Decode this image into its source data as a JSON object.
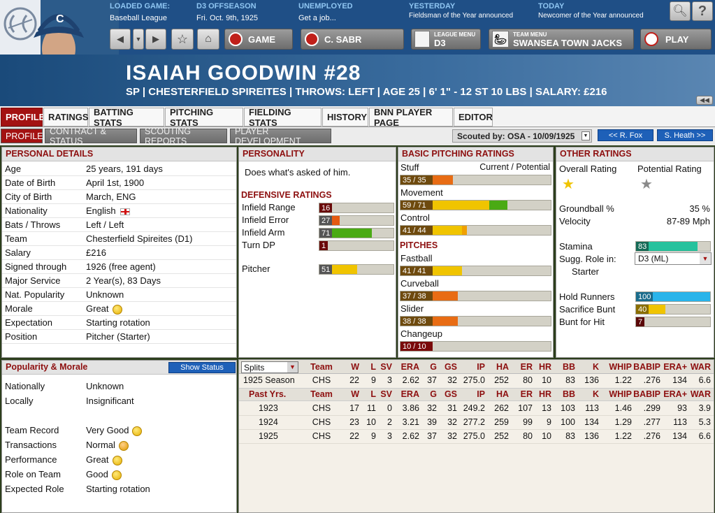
{
  "header": {
    "loaded_game": {
      "label": "LOADED GAME:",
      "value": "Baseball League"
    },
    "phase": {
      "label": "D3 OFFSEASON",
      "value": "Fri. Oct. 9th, 1925"
    },
    "status": {
      "label": "UNEMPLOYED",
      "value": "Get a job..."
    },
    "yesterday": {
      "label": "YESTERDAY",
      "value": "Fieldsman of the Year announced"
    },
    "today": {
      "label": "TODAY",
      "value": "Newcomer of the Year announced"
    },
    "buttons": {
      "game": "GAME",
      "team_short": "C. SABR",
      "league_menu_label": "LEAGUE MENU",
      "league": "D3",
      "team_menu_label": "TEAM MENU",
      "team": "SWANSEA TOWN JACKS",
      "play": "PLAY"
    },
    "cap_letter": "C"
  },
  "player": {
    "name": "ISAIAH GOODWIN  #28",
    "subtitle": "SP | CHESTERFIELD SPIREITES | THROWS: LEFT | AGE 25 | 6' 1\" - 12 ST 10 LBS | SALARY: £216"
  },
  "tabs": [
    "PROFILE",
    "RATINGS",
    "BATTING STATS",
    "PITCHING STATS",
    "FIELDING STATS",
    "HISTORY",
    "BNN PLAYER PAGE",
    "EDITOR"
  ],
  "subtabs": [
    "PROFILE",
    "CONTRACT & STATUS",
    "SCOUTING REPORTS",
    "PLAYER DEVELOPMENT"
  ],
  "scouted_by": "Scouted by: OSA - 10/09/1925",
  "prev_player": "<< R. Fox",
  "next_player": "S. Heath >>",
  "personal": {
    "title": "PERSONAL DETAILS",
    "rows": [
      {
        "k": "Age",
        "v": "25 years, 191 days"
      },
      {
        "k": "Date of Birth",
        "v": "April 1st, 1900"
      },
      {
        "k": "City of Birth",
        "v": "March, ENG"
      },
      {
        "k": "Nationality",
        "v": "English"
      },
      {
        "k": "Bats / Throws",
        "v": "Left / Left"
      },
      {
        "k": "Team",
        "v": "Chesterfield Spireites (D1)"
      },
      {
        "k": "Salary",
        "v": "£216"
      },
      {
        "k": "Signed through",
        "v": "1926 (free agent)"
      },
      {
        "k": "Major Service",
        "v": "2 Year(s), 83 Days"
      },
      {
        "k": "Nat. Popularity",
        "v": "Unknown"
      },
      {
        "k": "Morale",
        "v": "Great"
      },
      {
        "k": "Expectation",
        "v": "Starting rotation"
      },
      {
        "k": "Position",
        "v": "Pitcher (Starter)"
      }
    ]
  },
  "popularity": {
    "title": "Popularity & Morale",
    "show_status": "Show Status",
    "rows": [
      {
        "k": "Nationally",
        "v": "Unknown"
      },
      {
        "k": "Locally",
        "v": "Insignificant"
      },
      {
        "k": "Team Record",
        "v": "Very Good"
      },
      {
        "k": "Transactions",
        "v": "Normal"
      },
      {
        "k": "Performance",
        "v": "Great"
      },
      {
        "k": "Role on Team",
        "v": "Good"
      },
      {
        "k": "Expected Role",
        "v": "Starting rotation"
      }
    ]
  },
  "personality": {
    "title": "PERSONALITY",
    "text": "Does what's asked of him."
  },
  "defensive": {
    "title": "DEFENSIVE RATINGS",
    "rows": [
      {
        "k": "Infield Range",
        "v": "16",
        "level": 16,
        "color": "#b01515"
      },
      {
        "k": "Infield Error",
        "v": "27",
        "level": 27,
        "color": "#e55a10"
      },
      {
        "k": "Infield Arm",
        "v": "71",
        "level": 71,
        "color": "#4aaa14"
      },
      {
        "k": "Turn DP",
        "v": "1",
        "level": 1,
        "color": "#666666"
      }
    ],
    "pitcher": {
      "k": "Pitcher",
      "v": "51",
      "level": 51,
      "color": "#f0c400"
    }
  },
  "pitching": {
    "title": "BASIC PITCHING RATINGS",
    "current_potential": "Current / Potential",
    "ratings": [
      {
        "k": "Stuff",
        "v": "35 / 35",
        "cur": 35,
        "pot": 35,
        "color": "#e86c14"
      },
      {
        "k": "Movement",
        "v": "59 / 71",
        "cur": 59,
        "pot": 71,
        "color": "#f0c400",
        "pot_color": "#4aaa14"
      },
      {
        "k": "Control",
        "v": "41 / 44",
        "cur": 41,
        "pot": 44,
        "color": "#f0c400",
        "pot_color": "#f0a000"
      }
    ],
    "pitches_title": "PITCHES",
    "pitches": [
      {
        "k": "Fastball",
        "v": "41 / 41",
        "cur": 41,
        "pot": 41,
        "color": "#f0c400"
      },
      {
        "k": "Curveball",
        "v": "37 / 38",
        "cur": 37,
        "pot": 38,
        "color": "#e86c14"
      },
      {
        "k": "Slider",
        "v": "38 / 38",
        "cur": 38,
        "pot": 38,
        "color": "#e86c14"
      },
      {
        "k": "Changeup",
        "v": "10 / 10",
        "cur": 10,
        "pot": 10,
        "color": "#c01010"
      }
    ]
  },
  "other": {
    "title": "OTHER RATINGS",
    "overall_label": "Overall Rating",
    "potential_label": "Potential Rating",
    "groundball_label": "Groundball %",
    "groundball": "35 %",
    "velocity_label": "Velocity",
    "velocity": "87-89 Mph",
    "stamina_label": "Stamina",
    "stamina": "83",
    "stamina_level": 83,
    "role_label": "Sugg. Role in:",
    "role_select": "D3 (ML)",
    "role_value": "Starter",
    "hold_label": "Hold Runners",
    "hold": "100",
    "hold_level": 100,
    "sac_label": "Sacrifice Bunt",
    "sac": "40",
    "sac_level": 40,
    "bunt_label": "Bunt for Hit",
    "bunt": "7",
    "bunt_level": 7
  },
  "stats": {
    "splits": "Splits",
    "headers": [
      "Team",
      "W",
      "L",
      "SV",
      "ERA",
      "G",
      "GS",
      "IP",
      "HA",
      "ER",
      "HR",
      "BB",
      "K",
      "WHIP",
      "BABIP",
      "ERA+",
      "WAR"
    ],
    "season_row": {
      "label": "1925 Season",
      "cells": [
        "CHS",
        "22",
        "9",
        "3",
        "2.62",
        "37",
        "32",
        "275.0",
        "252",
        "80",
        "10",
        "83",
        "136",
        "1.22",
        ".276",
        "134",
        "6.6"
      ]
    },
    "past_label": "Past Yrs.",
    "past_rows": [
      {
        "label": "1923",
        "cells": [
          "CHS",
          "17",
          "11",
          "0",
          "3.86",
          "32",
          "31",
          "249.2",
          "262",
          "107",
          "13",
          "103",
          "113",
          "1.46",
          ".299",
          "93",
          "3.9"
        ]
      },
      {
        "label": "1924",
        "cells": [
          "CHS",
          "23",
          "10",
          "2",
          "3.21",
          "39",
          "32",
          "277.2",
          "259",
          "99",
          "9",
          "100",
          "134",
          "1.29",
          ".277",
          "113",
          "5.3"
        ]
      },
      {
        "label": "1925",
        "cells": [
          "CHS",
          "22",
          "9",
          "3",
          "2.62",
          "37",
          "32",
          "275.0",
          "252",
          "80",
          "10",
          "83",
          "136",
          "1.22",
          ".276",
          "134",
          "6.6"
        ]
      }
    ]
  }
}
